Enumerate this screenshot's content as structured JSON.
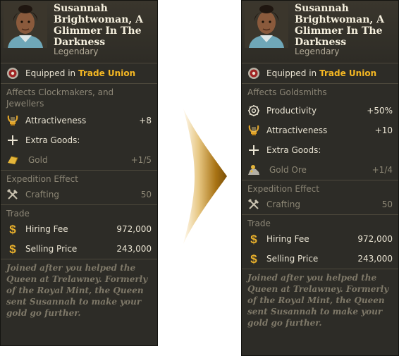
{
  "left": {
    "name": "Susannah Brightwoman, A Glimmer In The Darkness",
    "rarity": "Legendary",
    "equipped_prefix": "Equipped in",
    "equipped_location": "Trade Union",
    "affects": "Affects Clockmakers, and Jewellers",
    "stats": [
      {
        "icon": "lyre-icon",
        "label": "Attractiveness",
        "value": "+8",
        "muted": false
      },
      {
        "icon": "plus-icon",
        "label": "Extra Goods:",
        "value": "",
        "muted": false
      },
      {
        "icon": "gold-bar-icon",
        "label": "Gold",
        "value": "+1/5",
        "muted": true
      }
    ],
    "expedition_title": "Expedition Effect",
    "expedition": {
      "label": "Crafting",
      "value": "50"
    },
    "trade_title": "Trade",
    "trade": [
      {
        "label": "Hiring Fee",
        "value": "972,000"
      },
      {
        "label": "Selling Price",
        "value": "243,000"
      }
    ],
    "flavor": "Joined after you helped the Queen at Trelawney. Formerly of the Royal Mint, the Queen sent Susannah to make your gold go further."
  },
  "right": {
    "name": "Susannah Brightwoman, A Glimmer In The Darkness",
    "rarity": "Legendary",
    "equipped_prefix": "Equipped in",
    "equipped_location": "Trade Union",
    "affects": "Affects Goldsmiths",
    "stats": [
      {
        "icon": "gear-icon",
        "label": "Productivity",
        "value": "+50%",
        "muted": false
      },
      {
        "icon": "lyre-icon",
        "label": "Attractiveness",
        "value": "+10",
        "muted": false
      },
      {
        "icon": "plus-icon",
        "label": "Extra Goods:",
        "value": "",
        "muted": false
      },
      {
        "icon": "gold-ore-icon",
        "label": "Gold Ore",
        "value": "+1/4",
        "muted": true
      }
    ],
    "expedition_title": "Expedition Effect",
    "expedition": {
      "label": "Crafting",
      "value": "50"
    },
    "trade_title": "Trade",
    "trade": [
      {
        "label": "Hiring Fee",
        "value": "972,000"
      },
      {
        "label": "Selling Price",
        "value": "243,000"
      }
    ],
    "flavor": "Joined after you helped the Queen at Trelawney. Formerly of the Royal Mint, the Queen sent Susannah to make your gold go further."
  },
  "colors": {
    "panel": "#2d2c27",
    "highlight": "#f5b823",
    "text": "#e9e3d2",
    "muted": "#8d8775"
  }
}
